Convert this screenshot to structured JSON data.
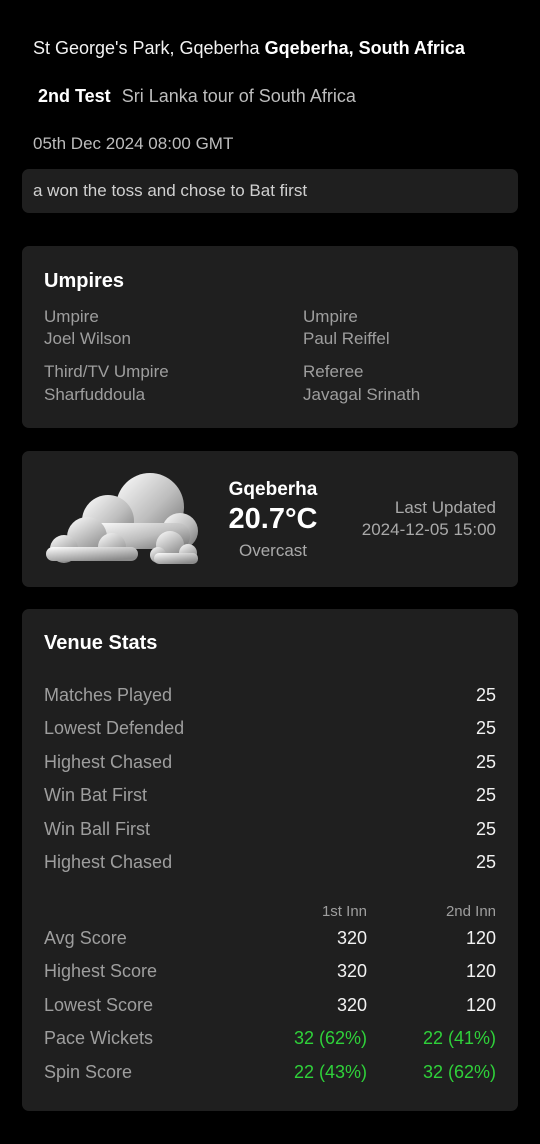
{
  "header": {
    "venue": "St George's Park, Gqeberha",
    "location": "Gqeberha, South Africa",
    "match_number": "2nd Test",
    "tour": "Sri Lanka tour of South Africa",
    "datetime": "05th Dec 2024 08:00 GMT",
    "toss": "a won the toss and chose to Bat first"
  },
  "officials": {
    "title": "Umpires",
    "items": [
      {
        "role": "Umpire",
        "name": "Joel Wilson"
      },
      {
        "role": "Umpire",
        "name": "Paul Reiffel"
      },
      {
        "role": "Third/TV Umpire",
        "name": "Sharfuddoula"
      },
      {
        "role": "Referee",
        "name": "Javagal Srinath"
      }
    ]
  },
  "weather": {
    "city": "Gqeberha",
    "temperature": "20.7°C",
    "condition": "Overcast",
    "updated_label": "Last Updated",
    "updated_time": "2024-12-05 15:00",
    "icon": "cloud-icon"
  },
  "venue_stats": {
    "title": "Venue Stats",
    "rows": [
      {
        "label": "Matches Played",
        "value": "25"
      },
      {
        "label": "Lowest Defended",
        "value": "25"
      },
      {
        "label": "Highest Chased",
        "value": "25"
      },
      {
        "label": "Win Bat First",
        "value": "25"
      },
      {
        "label": "Win Ball First",
        "value": "25"
      },
      {
        "label": "Highest Chased",
        "value": "25"
      }
    ],
    "innings_headers": [
      "1st Inn",
      "2nd Inn"
    ],
    "innings_rows": [
      {
        "label": "Avg Score",
        "first": "320",
        "second": "120"
      },
      {
        "label": "Highest Score",
        "first": "320",
        "second": "120"
      },
      {
        "label": "Lowest Score",
        "first": "320",
        "second": "120"
      },
      {
        "label": "Pace Wickets",
        "first": "32 (62%)",
        "second": "22 (41%)"
      },
      {
        "label": "Spin Score",
        "first": "22 (43%)",
        "second": "32 (62%)"
      }
    ]
  },
  "colors": {
    "background": "#000000",
    "card": "#1f1f1f",
    "highlight_green": "#2fd13a"
  }
}
